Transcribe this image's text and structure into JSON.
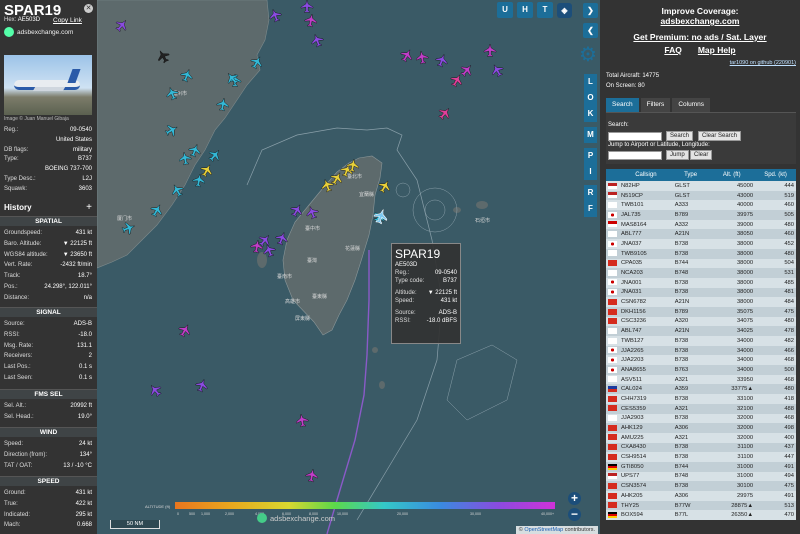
{
  "selected": {
    "callsign": "SPAR19",
    "hex_label": "Hex:",
    "hex": "AE503D",
    "copy_link": "Copy Link",
    "brand": "adsbexchange.com",
    "photo_credit": "Image © Juan Manuel Gibaja",
    "info": [
      {
        "k": "Reg.:",
        "v": "09-0540"
      },
      {
        "k": "",
        "v": "United States"
      },
      {
        "k": "DB flags:",
        "v": "military"
      },
      {
        "k": "Type:",
        "v": "B737"
      },
      {
        "k": "",
        "v": "BOEING 737-700"
      },
      {
        "k": "Type Desc.:",
        "v": "L2J"
      },
      {
        "k": "Squawk:",
        "v": "3603"
      }
    ],
    "history_label": "History",
    "spatial_header": "SPATIAL",
    "spatial": [
      {
        "k": "Groundspeed:",
        "v": "431 kt"
      },
      {
        "k": "Baro. Altitude:",
        "v": "▼ 22125 ft"
      },
      {
        "k": "WGS84 altitude:",
        "v": "▼ 23650 ft"
      },
      {
        "k": "Vert. Rate:",
        "v": "-2432 ft/min"
      },
      {
        "k": "Track:",
        "v": "18.7°"
      },
      {
        "k": "Pos.:",
        "v": "24.298°, 122.011°"
      },
      {
        "k": "Distance:",
        "v": "n/a"
      }
    ],
    "signal_header": "SIGNAL",
    "signal": [
      {
        "k": "Source:",
        "v": "ADS-B"
      },
      {
        "k": "RSSI:",
        "v": "-18.0"
      },
      {
        "k": "Msg. Rate:",
        "v": "131.1"
      },
      {
        "k": "Receivers:",
        "v": "2"
      },
      {
        "k": "Last Pos.:",
        "v": "0.1 s"
      },
      {
        "k": "Last Seen:",
        "v": "0.1 s"
      }
    ],
    "fms_header": "FMS SEL",
    "fms": [
      {
        "k": "Sel. Alt.:",
        "v": "20992 ft"
      },
      {
        "k": "Sel. Head.:",
        "v": "19.0°"
      }
    ],
    "wind_header": "WIND",
    "wind": [
      {
        "k": "Speed:",
        "v": "24 kt"
      },
      {
        "k": "Direction (from):",
        "v": "134°"
      },
      {
        "k": "TAT / OAT:",
        "v": "13 / -10 °C"
      }
    ],
    "speed_header": "SPEED",
    "speed": [
      {
        "k": "Ground:",
        "v": "431 kt"
      },
      {
        "k": "True:",
        "v": "422 kt"
      },
      {
        "k": "Indicated:",
        "v": "295 kt"
      },
      {
        "k": "Mach:",
        "v": "0.668"
      }
    ]
  },
  "popup": {
    "callsign": "SPAR19",
    "hex": "AE503D",
    "rows": [
      {
        "k": "Reg.:",
        "v": "09-0540"
      },
      {
        "k": "Type code:",
        "v": "B737"
      },
      {
        "k": "Altitude:",
        "v": "▼ 22125 ft"
      },
      {
        "k": "Speed:",
        "v": "431 kt"
      },
      {
        "k": "Source:",
        "v": "ADS-B"
      },
      {
        "k": "RSSI:",
        "v": "-18.0 dBFS"
      }
    ]
  },
  "map": {
    "top_buttons": [
      "U",
      "H",
      "T"
    ],
    "side_buttons": [
      "L",
      "O",
      "K",
      "M",
      "P",
      "I",
      "R",
      "F"
    ],
    "scale_label": "50 NM",
    "logo_text": "adsbexchange.com",
    "altitude_label": "ALTITUDE (ft)",
    "altitude_ticks": [
      "0",
      "500",
      "1,000",
      "2,000",
      "4,000",
      "6,000",
      "8,000",
      "10,000",
      "20,000",
      "30,000",
      "40,000+"
    ],
    "attribution_prefix": "©",
    "attribution_link": "OpenStreetMap",
    "attribution_suffix": "contributors.",
    "labels": {
      "taiwan": "臺灣",
      "taichung": "臺中市",
      "taipei": "臺北市",
      "kaohsiung": "高雄市",
      "tainan": "臺南市",
      "hualien": "花蓮縣",
      "taitung": "臺東縣",
      "yilan": "宜蘭縣",
      "pingtung": "屏東縣",
      "ishigaki": "石垣市",
      "fuzhou": "福州市",
      "xiamen": "厦门市"
    },
    "zoom_in": "+",
    "zoom_out": "−"
  },
  "right": {
    "improve_1": "Improve Coverage:",
    "improve_2": "adsbexchange.com",
    "premium": "Get Premium: no ads / Sat. Layer",
    "faq": "FAQ",
    "map_help": "Map Help",
    "github": "tar1090 on github (220901)",
    "total_aircraft": "Total Aircraft: 14775",
    "on_screen": "On Screen: 80",
    "tabs": [
      "Search",
      "Filters",
      "Columns"
    ],
    "search_label": "Search:",
    "search_btn": "Search",
    "clear_search_btn": "Clear Search",
    "jump_label": "Jump to Airport or Latitude, Longitude:",
    "jump_btn": "Jump",
    "clear_btn": "Clear",
    "columns": [
      "Callsign",
      "Type",
      "Alt. (ft)",
      "Spd. (kt)"
    ],
    "rows": [
      {
        "flag": "us",
        "callsign": "N82HP",
        "type": "GLST",
        "alt": "45000",
        "spd": "444"
      },
      {
        "flag": "us",
        "callsign": "N519CP",
        "type": "GLST",
        "alt": "43000",
        "spd": "519"
      },
      {
        "flag": "kr",
        "callsign": "TWB101",
        "type": "A333",
        "alt": "40000",
        "spd": "460"
      },
      {
        "flag": "jp",
        "callsign": "JAL735",
        "type": "B789",
        "alt": "39975",
        "spd": "505"
      },
      {
        "flag": "my",
        "callsign": "MAS8164",
        "type": "A332",
        "alt": "39000",
        "spd": "480"
      },
      {
        "flag": "kr",
        "callsign": "ABL777",
        "type": "A21N",
        "alt": "38050",
        "spd": "460"
      },
      {
        "flag": "jp",
        "callsign": "JNA037",
        "type": "B738",
        "alt": "38000",
        "spd": "452"
      },
      {
        "flag": "kr",
        "callsign": "TWB9105",
        "type": "B738",
        "alt": "38000",
        "spd": "480"
      },
      {
        "flag": "cn",
        "callsign": "CPA035",
        "type": "B744",
        "alt": "38000",
        "spd": "504"
      },
      {
        "flag": "kr",
        "callsign": "NCA203",
        "type": "B748",
        "alt": "38000",
        "spd": "531"
      },
      {
        "flag": "jp",
        "callsign": "JNA001",
        "type": "B738",
        "alt": "38000",
        "spd": "485"
      },
      {
        "flag": "jp",
        "callsign": "JNA031",
        "type": "B738",
        "alt": "38000",
        "spd": "481"
      },
      {
        "flag": "cn",
        "callsign": "CSN6782",
        "type": "A21N",
        "alt": "38000",
        "spd": "484"
      },
      {
        "flag": "cn",
        "callsign": "DKH1156",
        "type": "B789",
        "alt": "35075",
        "spd": "475"
      },
      {
        "flag": "cn",
        "callsign": "CSC3236",
        "type": "A320",
        "alt": "34075",
        "spd": "480"
      },
      {
        "flag": "kr",
        "callsign": "ABL747",
        "type": "A21N",
        "alt": "34025",
        "spd": "478"
      },
      {
        "flag": "kr",
        "callsign": "TWB127",
        "type": "B738",
        "alt": "34000",
        "spd": "482"
      },
      {
        "flag": "jp",
        "callsign": "JJA2265",
        "type": "B738",
        "alt": "34000",
        "spd": "466"
      },
      {
        "flag": "jp",
        "callsign": "JJA2203",
        "type": "B738",
        "alt": "34000",
        "spd": "468"
      },
      {
        "flag": "jp",
        "callsign": "ANA8655",
        "type": "B763",
        "alt": "34000",
        "spd": "500"
      },
      {
        "flag": "kr",
        "callsign": "ASV511",
        "type": "A321",
        "alt": "33950",
        "spd": "468"
      },
      {
        "flag": "tw",
        "callsign": "CAL024",
        "type": "A359",
        "alt": "33775▲",
        "spd": "480"
      },
      {
        "flag": "cn",
        "callsign": "CHH7319",
        "type": "B738",
        "alt": "33100",
        "spd": "418"
      },
      {
        "flag": "cn",
        "callsign": "CES5359",
        "type": "A321",
        "alt": "32100",
        "spd": "488"
      },
      {
        "flag": "kr",
        "callsign": "JJA2903",
        "type": "B738",
        "alt": "32000",
        "spd": "468"
      },
      {
        "flag": "cn",
        "callsign": "AHK129",
        "type": "A306",
        "alt": "32000",
        "spd": "498"
      },
      {
        "flag": "cn",
        "callsign": "AMU225",
        "type": "A321",
        "alt": "32000",
        "spd": "400"
      },
      {
        "flag": "cn",
        "callsign": "CXA8430",
        "type": "B738",
        "alt": "31100",
        "spd": "437"
      },
      {
        "flag": "cn",
        "callsign": "CSH9514",
        "type": "B738",
        "alt": "31100",
        "spd": "447"
      },
      {
        "flag": "de",
        "callsign": "GTI8050",
        "type": "B744",
        "alt": "31000",
        "spd": "491"
      },
      {
        "flag": "us",
        "callsign": "UPS77",
        "type": "B748",
        "alt": "31000",
        "spd": "494"
      },
      {
        "flag": "cn",
        "callsign": "CSN3574",
        "type": "B738",
        "alt": "30100",
        "spd": "475"
      },
      {
        "flag": "cn",
        "callsign": "AHK205",
        "type": "A306",
        "alt": "29975",
        "spd": "491"
      },
      {
        "flag": "cn",
        "callsign": "THY25",
        "type": "B77W",
        "alt": "28875▲",
        "spd": "513"
      },
      {
        "flag": "de",
        "callsign": "BOX594",
        "type": "B77L",
        "alt": "26350▲",
        "spd": "470"
      }
    ]
  },
  "colors": {
    "accent": "#1c6e99",
    "panel": "#333333",
    "sea": "#3a5a66",
    "land": "#5d6a6c",
    "aircraft_magenta": "#c03ec8",
    "aircraft_cyan": "#33b8d6",
    "aircraft_violet": "#8a4be0",
    "aircraft_pink": "#e0409a",
    "aircraft_yellow": "#e8d03a"
  }
}
